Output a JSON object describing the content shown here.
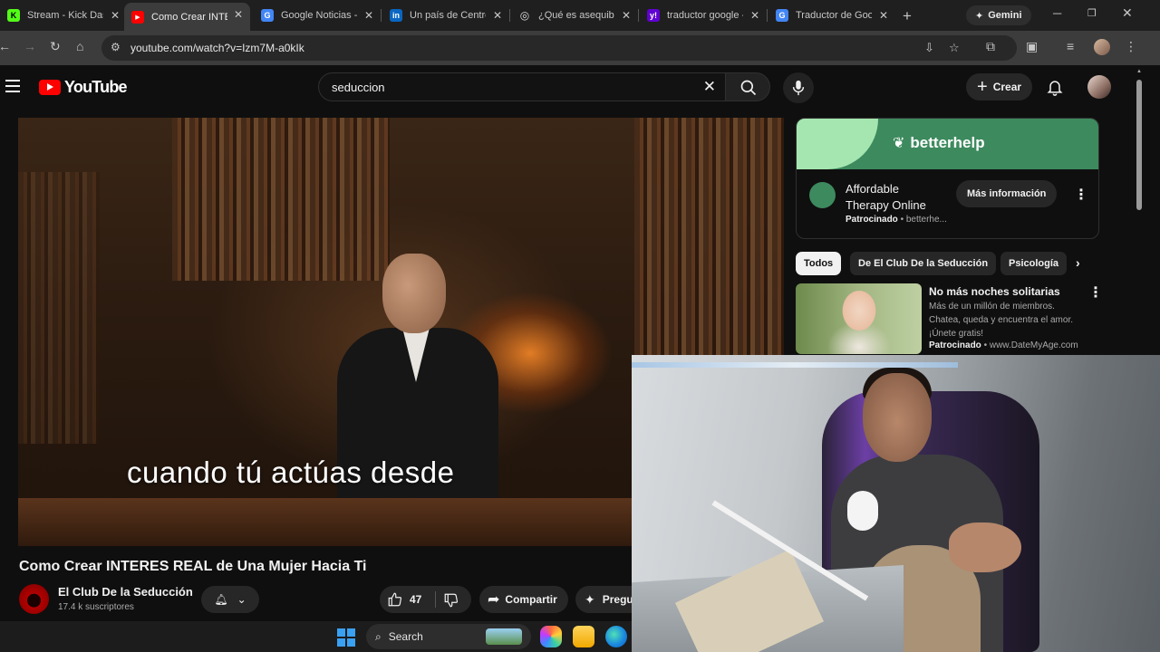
{
  "browser": {
    "tabs": [
      {
        "title": "Stream - Kick Dash",
        "favicon": "K",
        "color": "#53fc18",
        "active": false
      },
      {
        "title": "Como Crear INTER",
        "favicon": "▶",
        "color": "#ff0000",
        "active": true
      },
      {
        "title": "Google Noticias - l",
        "favicon": "G",
        "color": "#4285f4",
        "active": false
      },
      {
        "title": "Un país de Centro",
        "favicon": "in",
        "color": "#0a66c2",
        "active": false
      },
      {
        "title": "¿Qué es asequibilic",
        "favicon": "◎",
        "color": "#cccccc",
        "active": false
      },
      {
        "title": "traductor google -",
        "favicon": "y!",
        "color": "#6001d2",
        "active": false
      },
      {
        "title": "Traductor de Goog",
        "favicon": "G",
        "color": "#4285f4",
        "active": false
      }
    ],
    "gemini_label": "Gemini",
    "url": "youtube.com/watch?v=Izm7M-a0kIk"
  },
  "youtube": {
    "logo_text": "YouTube",
    "search": {
      "query": "seduccion"
    },
    "create_label": "Crear",
    "video": {
      "subtitle": "cuando tú actúas desde ",
      "title": "Como Crear INTERES REAL de Una Mujer Hacia Ti",
      "channel": "El Club De la Seducción",
      "subscribers": "17.4 k suscriptores",
      "likes": "47",
      "share_label": "Compartir",
      "ask_label": "Pregu"
    },
    "ad": {
      "brand": "betterhelp",
      "title": "Affordable Therapy Online",
      "sponsored_label": "Patrocinado",
      "domain": "betterhe...",
      "cta": "Más información"
    },
    "chips": [
      "Todos",
      "De El Club De la Seducción",
      "Psicología"
    ],
    "ad2": {
      "title": "No más noches solitarias",
      "description": "Más de un millón de miembros. Chatea, queda y encuentra el amor. ¡Únete gratis!",
      "sponsored_label": "Patrocinado",
      "domain": "www.DateMyAge.com"
    }
  },
  "taskbar": {
    "search_label": "Search"
  },
  "colors": {
    "yt_bg": "#0f0f0f",
    "yt_red": "#ff0000",
    "chip_bg": "#272727",
    "betterhelp_green": "#3d8a5e"
  }
}
